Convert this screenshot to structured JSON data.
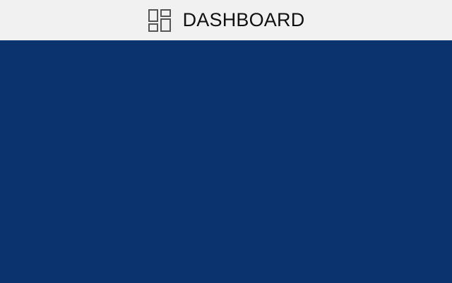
{
  "header": {
    "title": "DASHBOARD",
    "icon": "dashboard-icon"
  },
  "colors": {
    "header_background": "#f1f1f1",
    "main_background": "#0b346e",
    "title_text": "#111111",
    "icon_stroke": "#555555"
  }
}
